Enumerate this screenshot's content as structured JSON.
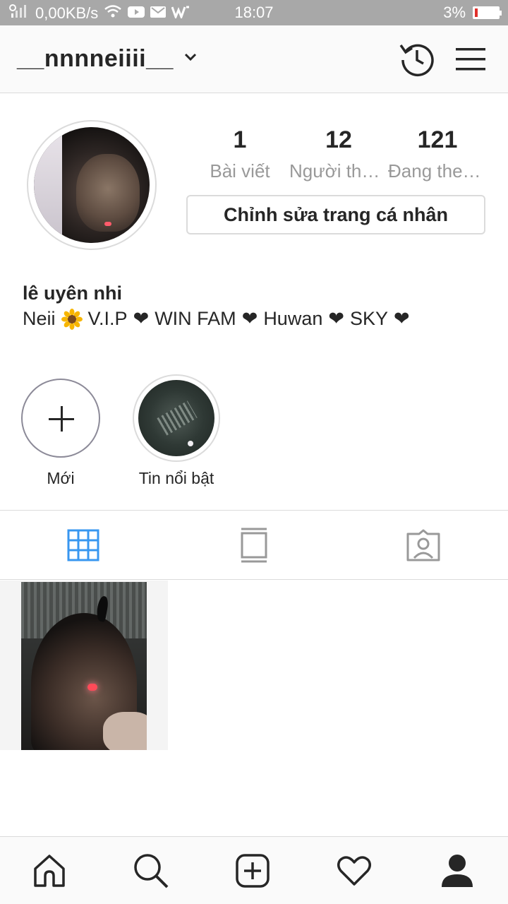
{
  "status_bar": {
    "network_speed": "0,00KB/s",
    "time": "18:07",
    "battery": "3%",
    "battery_level": 0.03,
    "colors": {
      "bar": "#a8a8a8",
      "battery_low": "#e0302b"
    }
  },
  "header": {
    "username": "__nnnneiiii__",
    "icons": [
      "chevron-down-icon",
      "history-icon",
      "menu-icon"
    ]
  },
  "profile": {
    "stats": [
      {
        "value": "1",
        "label": "Bài viết"
      },
      {
        "value": "12",
        "label": "Người theo dõi"
      },
      {
        "value": "121",
        "label": "Đang theo dõi"
      }
    ],
    "edit_button_label": "Chỉnh sửa trang cá nhân",
    "full_name": "lê uyên nhi",
    "bio": {
      "name": "Neii",
      "emoji": "🌻",
      "items": [
        "V.I.P",
        "WIN FAM",
        "Huwan",
        "SKY"
      ],
      "separator": "❤"
    }
  },
  "highlights": [
    {
      "label": "Mới",
      "type": "new"
    },
    {
      "label": "Tin nổi bật",
      "type": "story"
    }
  ],
  "tabs": [
    {
      "name": "grid",
      "icon": "grid-icon",
      "active": true
    },
    {
      "name": "feed",
      "icon": "feed-icon",
      "active": false
    },
    {
      "name": "tagged",
      "icon": "tagged-icon",
      "active": false
    }
  ],
  "accent_color": "#3897f0",
  "bottom_nav": [
    "home-icon",
    "search-icon",
    "add-post-icon",
    "activity-heart-icon",
    "profile-icon"
  ]
}
